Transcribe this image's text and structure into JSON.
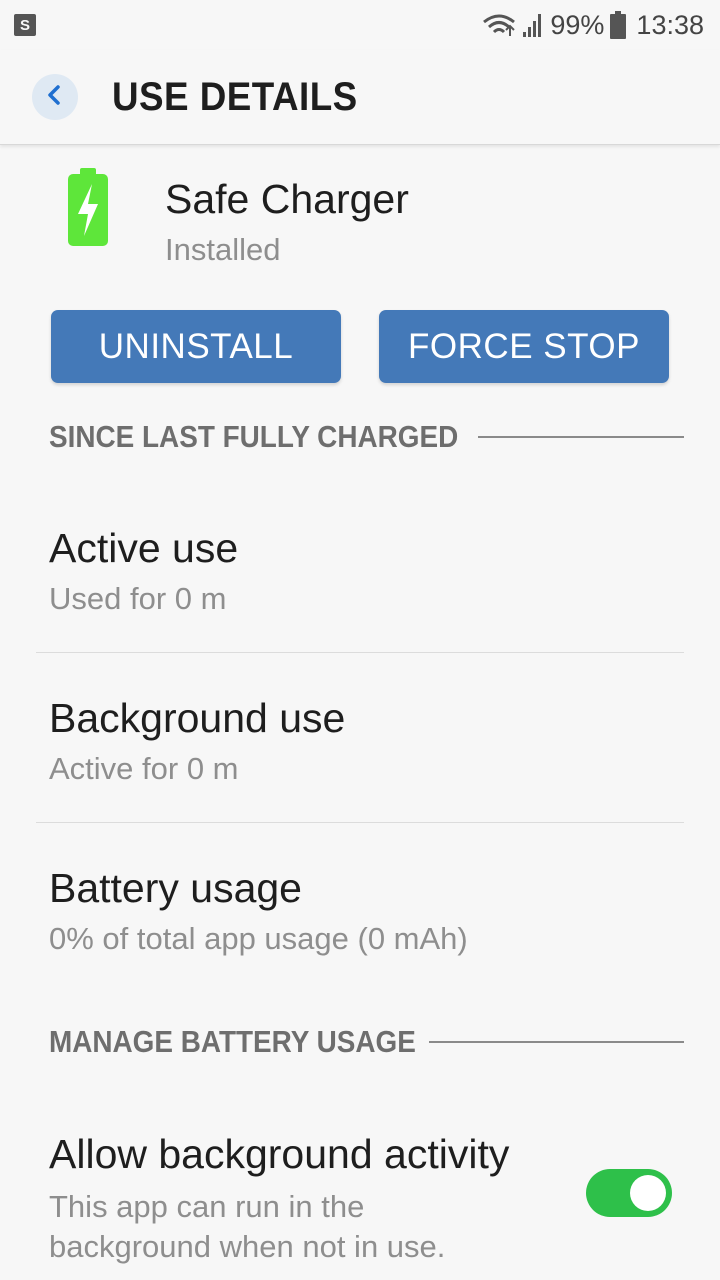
{
  "status_bar": {
    "notification_icon": "s-notification-icon",
    "battery_percent": "99%",
    "time": "13:38"
  },
  "header": {
    "back_icon": "chevron-left-icon",
    "title": "USE DETAILS"
  },
  "app": {
    "icon": "battery-charging-icon",
    "name": "Safe Charger",
    "status": "Installed"
  },
  "buttons": {
    "uninstall": "UNINSTALL",
    "force_stop": "FORCE STOP"
  },
  "sections": {
    "since_charged": "SINCE LAST FULLY CHARGED",
    "manage_battery": "MANAGE BATTERY USAGE"
  },
  "rows": {
    "active_use": {
      "title": "Active use",
      "subtitle": "Used for 0 m"
    },
    "background_use": {
      "title": "Background use",
      "subtitle": "Active for 0 m"
    },
    "battery_usage": {
      "title": "Battery usage",
      "subtitle": "0% of total app usage (0 mAh)"
    },
    "allow_background": {
      "title": "Allow background activity",
      "subtitle": "This app can run in the background when not in use.",
      "enabled": true
    }
  },
  "colors": {
    "accent_button": "#4479b8",
    "toggle_on": "#2ec04a",
    "app_icon_green": "#5ee63a"
  }
}
